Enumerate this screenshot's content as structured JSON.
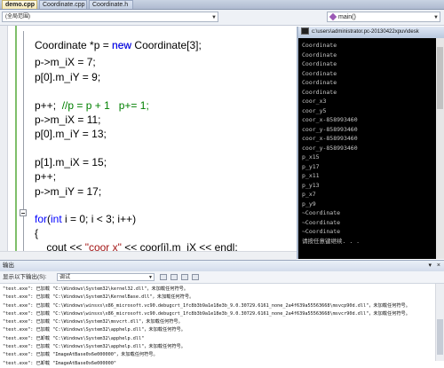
{
  "tabs": [
    {
      "label": "demo.cpp"
    },
    {
      "label": "Coordinate.cpp"
    },
    {
      "label": "Coordinate.h"
    }
  ],
  "navbar": {
    "scope": "(全局范围)",
    "function": "main()"
  },
  "code_lines": [
    "Coordinate *p = new Coordinate[3];",
    "p->m_iX = 7;",
    "p[0].m_iY = 9;",
    "",
    "p++;  //p = p + 1   p+= 1;",
    "p->m_iX = 11;",
    "p[0].m_iY = 13;",
    "",
    "p[1].m_iX = 15;",
    "p++;",
    "p->m_iY = 17;",
    "",
    "for(int i = 0; i < 3; i++)",
    "{",
    "    cout << \"coor x\" << coor[i].m_iX << endl;"
  ],
  "code_tokens": {
    "new_kw": "new",
    "comment": "//p = p + 1   p+= 1;",
    "for_kw": "for",
    "int_kw": "int",
    "string_literal": "\"coor x\""
  },
  "console": {
    "title": "c:\\users\\administrator.pc-20130422xpuv\\desk",
    "lines": [
      "Coordinate",
      "Coordinate",
      "Coordinate",
      "Coordinate",
      "Coordinate",
      "Coordinate",
      "coor_x3",
      "coor_y5",
      "coor_x-858993460",
      "coor_y-858993460",
      "coor_x-858993460",
      "coor_y-858993460",
      "p_x15",
      "p_y17",
      "p_x11",
      "p_y13",
      "p_x7",
      "p_y9",
      "~Coordinate",
      "~Coordinate",
      "~Coordinate",
      "请按任意键继续. . ."
    ]
  },
  "output": {
    "title": "输出",
    "show_from_label": "显示以下输出(S):",
    "show_from_value": "调试",
    "lines": [
      "\"test.exe\": 已加载 \"C:\\Windows\\System32\\kernel32.dll\"，未加载任何符号。",
      "\"test.exe\": 已加载 \"C:\\Windows\\System32\\KernelBase.dll\"，未加载任何符号。",
      "\"test.exe\": 已加载 \"C:\\Windows\\winsxs\\x86_microsoft.vc90.debugcrt_1fc8b3b9a1e18e3b_9.0.30729.6161_none_2a4f639a55563668\\msvcp90d.dll\"，未加载任何符号。",
      "\"test.exe\": 已加载 \"C:\\Windows\\winsxs\\x86_microsoft.vc90.debugcrt_1fc8b3b9a1e18e3b_9.0.30729.6161_none_2a4f639a55563668\\msvcr90d.dll\"，未加载任何符号。",
      "\"test.exe\": 已加载 \"C:\\Windows\\System32\\msvcrt.dll\"，未加载任何符号。",
      "\"test.exe\": 已加载 \"C:\\Windows\\System32\\apphelp.dll\"，未加载任何符号。",
      "\"test.exe\": 已卸载 \"C:\\Windows\\System32\\apphelp.dll\"",
      "\"test.exe\": 已加载 \"C:\\Windows\\System32\\apphelp.dll\"，未加载任何符号。",
      "\"test.exe\": 已加载 \"ImageAtBase0x6e000000\"，未加载任何符号。",
      "\"test.exe\": 已卸载 \"ImageAtBase0x6e000000\""
    ]
  }
}
